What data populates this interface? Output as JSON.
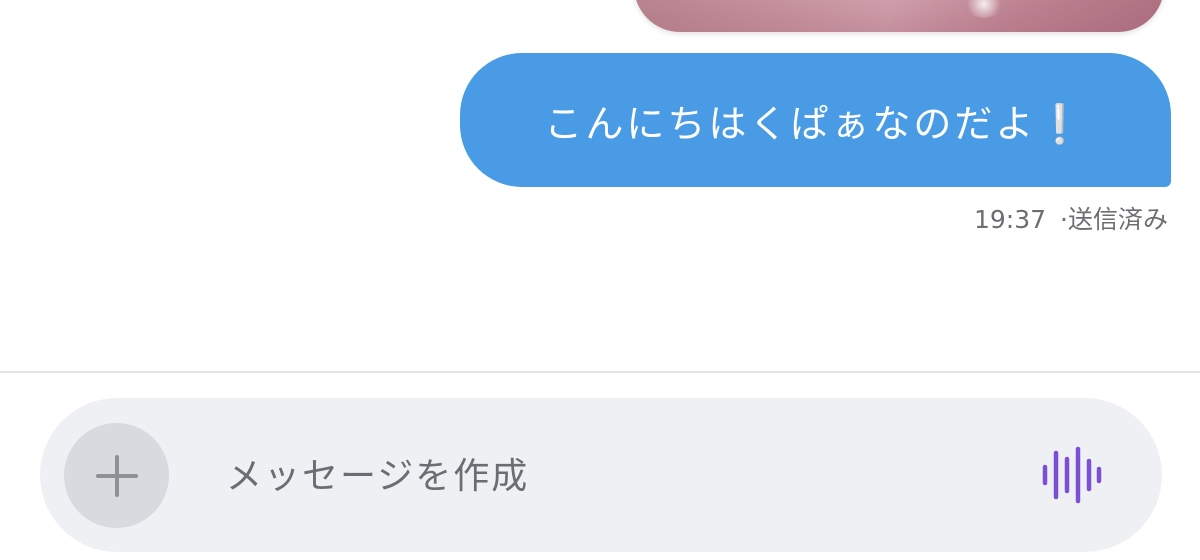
{
  "conversation": {
    "previous_image": {
      "icon": "photo-thumbnail"
    },
    "message": {
      "text": "こんにちはくぱぁなのだよ❕",
      "bubble_color": "#4a9be6",
      "time": "19:37",
      "status": "·送信済み"
    }
  },
  "composer": {
    "placeholder": "メッセージを作成",
    "add_icon": "plus-icon",
    "voice_icon": "voice-waveform-icon",
    "accent_color": "#7b4fd6"
  }
}
